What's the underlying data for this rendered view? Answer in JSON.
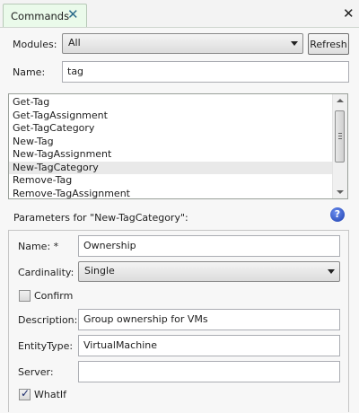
{
  "tab": {
    "title": "Commands"
  },
  "modules": {
    "label": "Modules:",
    "value": "All",
    "refresh_label": "Refresh"
  },
  "name_filter": {
    "label": "Name:",
    "value": "tag"
  },
  "commands": {
    "items": [
      "Get-Tag",
      "Get-TagAssignment",
      "Get-TagCategory",
      "New-Tag",
      "New-TagAssignment",
      "New-TagCategory",
      "Remove-Tag",
      "Remove-TagAssignment"
    ],
    "selected_index": 5
  },
  "parameters": {
    "title": "Parameters for \"New-TagCategory\":",
    "help_icon": "?",
    "name": {
      "label": "Name: *",
      "value": "Ownership"
    },
    "cardinality": {
      "label": "Cardinality:",
      "value": "Single"
    },
    "confirm": {
      "label": "Confirm",
      "checked": false
    },
    "description": {
      "label": "Description:",
      "value": "Group ownership for VMs"
    },
    "entity_type": {
      "label": "EntityType:",
      "value": "VirtualMachine"
    },
    "server": {
      "label": "Server:",
      "value": ""
    },
    "whatif": {
      "label": "WhatIf",
      "checked": true
    }
  }
}
